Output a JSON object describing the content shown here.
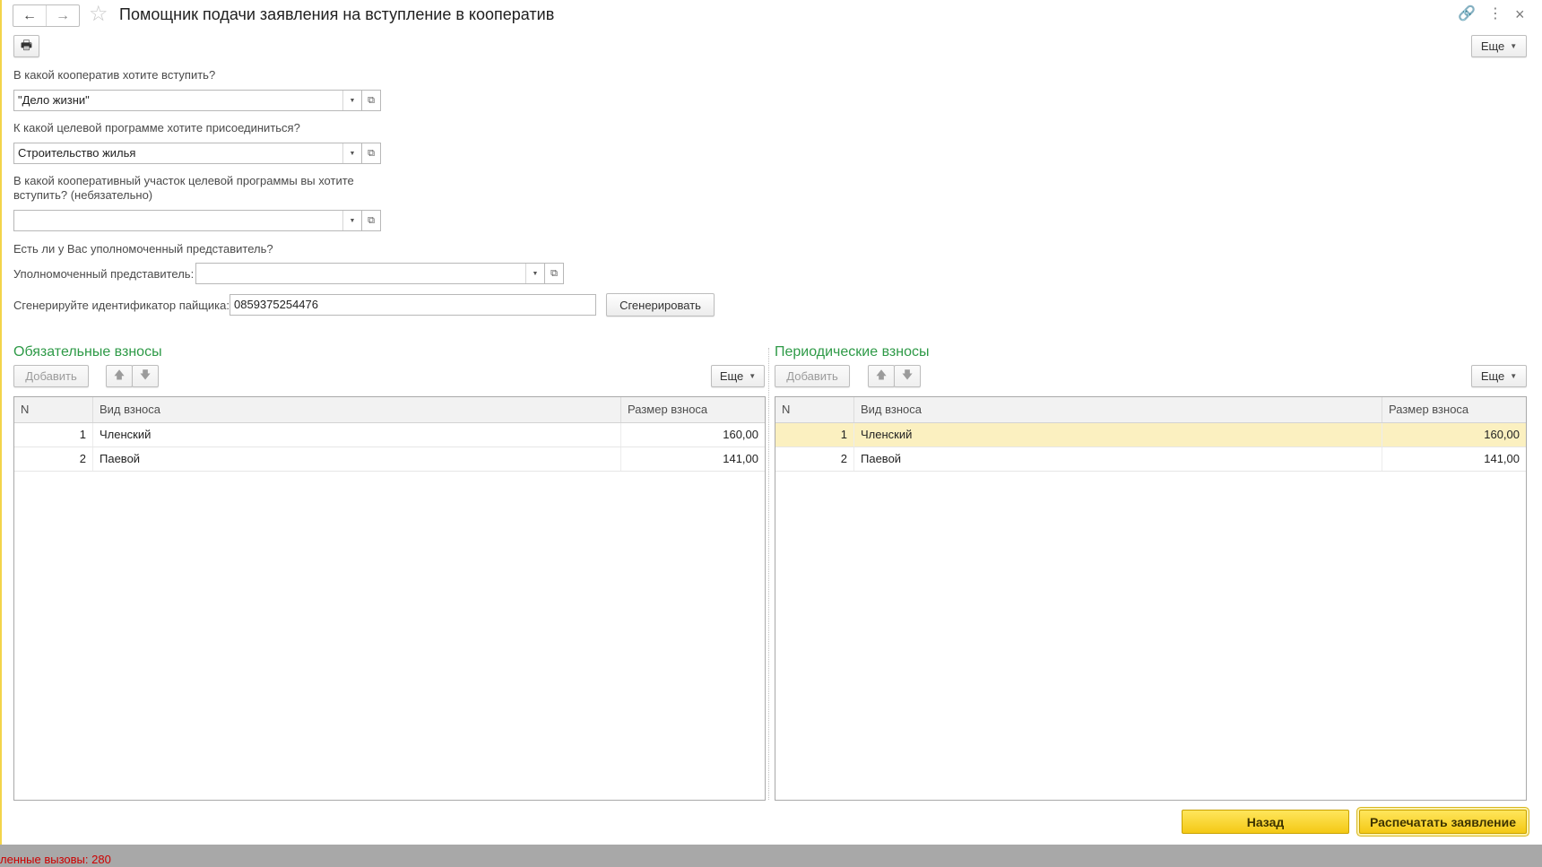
{
  "window": {
    "title": "Помощник подачи заявления на вступление в кооператив",
    "back_icon": "←",
    "forward_icon": "→",
    "star_icon": "☆",
    "link_icon": "🔗",
    "menu_icon": "⋮",
    "close_icon": "×"
  },
  "toolbar": {
    "print_icon": "🖶",
    "more_label": "Еще",
    "more_arrow": "▼"
  },
  "form": {
    "coop_question": "В какой кооператив хотите вступить?",
    "coop_value": "\"Дело жизни\"",
    "program_question": "К какой целевой программе хотите присоединиться?",
    "program_value": "Строительство жилья",
    "section_question": "В какой кооперативный участок целевой программы вы хотите вступить? (небязательно)",
    "section_value": "",
    "rep_question": "Есть ли у Вас уполномоченный представитель?",
    "rep_label": "Уполномоченный представитель:",
    "rep_value": "",
    "id_label": "Сгенерируйте идентификатор пайщика:",
    "id_value": "0859375254476",
    "generate_label": "Сгенерировать",
    "dropdown_glyph": "▼",
    "open_glyph": "⧉"
  },
  "mandatory": {
    "title": "Обязательные взносы",
    "add_label": "Добавить",
    "up_icon": "🡅",
    "down_icon": "🡇",
    "more_label": "Еще",
    "columns": [
      "N",
      "Вид взноса",
      "Размер взноса"
    ],
    "rows": [
      {
        "n": "1",
        "kind": "Членский",
        "size": "160,00"
      },
      {
        "n": "2",
        "kind": "Паевой",
        "size": "141,00"
      }
    ]
  },
  "periodic": {
    "title": "Периодические взносы",
    "add_label": "Добавить",
    "up_icon": "🡅",
    "down_icon": "🡇",
    "more_label": "Еще",
    "columns": [
      "N",
      "Вид взноса",
      "Размер взноса"
    ],
    "rows": [
      {
        "n": "1",
        "kind": "Членский",
        "size": "160,00"
      },
      {
        "n": "2",
        "kind": "Паевой",
        "size": "141,00"
      }
    ]
  },
  "footer": {
    "back_label": "Назад",
    "print_label": "Распечатать заявление"
  },
  "status": {
    "text": "ленные вызовы: 280"
  }
}
